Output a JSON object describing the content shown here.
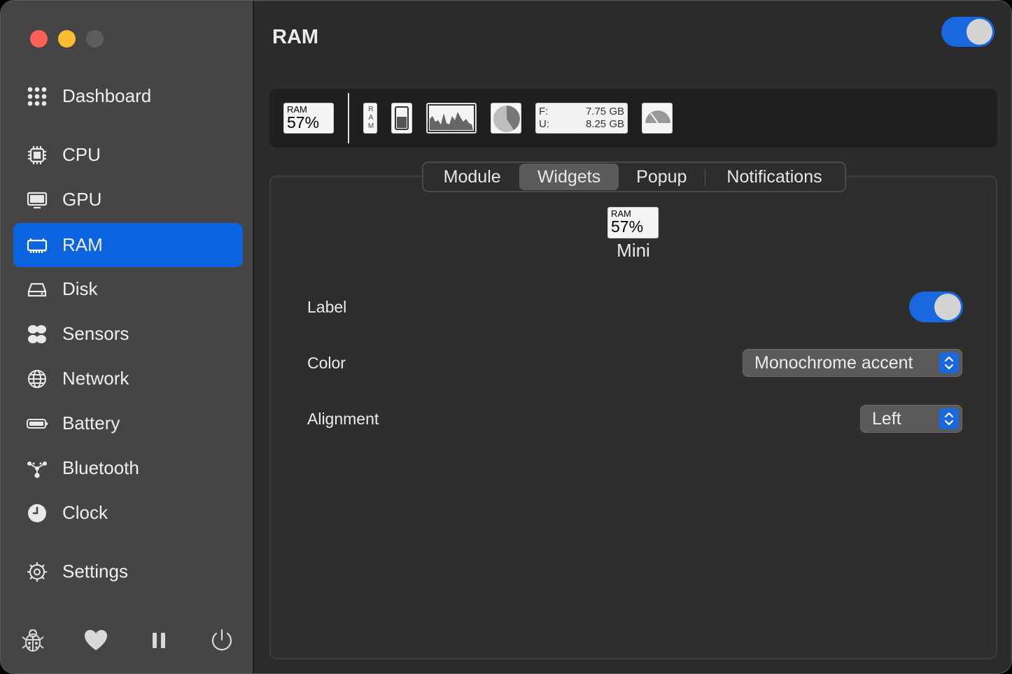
{
  "window": {
    "traffic_lights": [
      "close",
      "minimize",
      "maximize"
    ]
  },
  "sidebar": {
    "items": [
      {
        "label": "Dashboard",
        "icon": "dashboard-grid-icon"
      },
      {
        "label": "CPU",
        "icon": "cpu-chip-icon"
      },
      {
        "label": "GPU",
        "icon": "monitor-icon"
      },
      {
        "label": "RAM",
        "icon": "memory-icon",
        "active": true
      },
      {
        "label": "Disk",
        "icon": "disk-drive-icon"
      },
      {
        "label": "Sensors",
        "icon": "fan-icon"
      },
      {
        "label": "Network",
        "icon": "globe-icon"
      },
      {
        "label": "Battery",
        "icon": "battery-icon"
      },
      {
        "label": "Bluetooth",
        "icon": "bluetooth-nodes-icon"
      },
      {
        "label": "Clock",
        "icon": "clock-icon"
      },
      {
        "label": "Settings",
        "icon": "gear-icon"
      }
    ],
    "bottom_buttons": [
      "bug-report-icon",
      "heart-icon",
      "pause-icon",
      "power-icon"
    ]
  },
  "header": {
    "title": "RAM",
    "module_enabled": true
  },
  "widget_strip": {
    "mini": {
      "label": "RAM",
      "value": "57%"
    },
    "bar_chart_vertical_label": [
      "R",
      "A",
      "M"
    ],
    "memory_text": {
      "free_label": "F:",
      "free_value": "7.75 GB",
      "used_label": "U:",
      "used_value": "8.25 GB"
    }
  },
  "tabs": [
    {
      "label": "Module"
    },
    {
      "label": "Widgets",
      "active": true
    },
    {
      "label": "Popup"
    },
    {
      "label": "Notifications"
    }
  ],
  "widget_settings": {
    "preview": {
      "label": "RAM",
      "value": "57%",
      "caption": "Mini"
    },
    "rows": {
      "label": {
        "label": "Label",
        "enabled": true
      },
      "color": {
        "label": "Color",
        "value": "Monochrome accent"
      },
      "alignment": {
        "label": "Alignment",
        "value": "Left"
      }
    }
  },
  "colors": {
    "accent": "#0a64e0",
    "close": "#fe5f57",
    "minimize": "#febc2e"
  }
}
